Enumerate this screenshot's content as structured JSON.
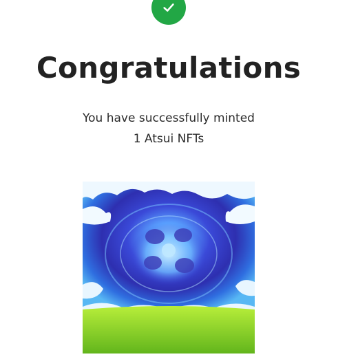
{
  "success_icon": "check-icon",
  "colors": {
    "success_green": "#22a745",
    "title_text": "#222222",
    "body_text": "#2b2b2b"
  },
  "title": "Congratulations",
  "message": {
    "line1": "You have successfully minted",
    "line2": "1 Atsui NFTs"
  },
  "nft_image": {
    "description_icon": "nft-artwork"
  }
}
